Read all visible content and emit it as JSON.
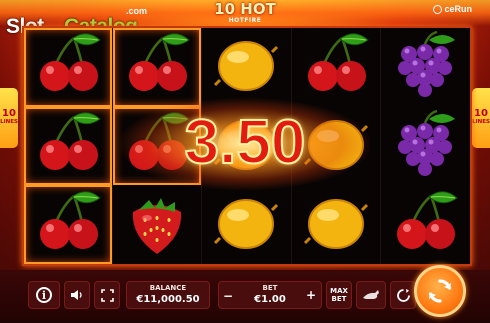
{
  "header": {
    "site_logo_main": "Slot",
    "site_logo_accent": "Catalog",
    "site_logo_tld": ".com",
    "game_title": "10 HOT",
    "game_subtitle": "HOTFIRE",
    "provider": "ceRun"
  },
  "side_tags": {
    "left_number": "10",
    "left_label": "LINES",
    "right_number": "10",
    "right_label": "LINES"
  },
  "reels": [
    [
      "cherry",
      "cherry",
      "lemon",
      "cherry",
      "grapes"
    ],
    [
      "cherry",
      "cherry",
      "lemon",
      "lemon",
      "grapes"
    ],
    [
      "cherry",
      "strawberry",
      "lemon",
      "lemon",
      "cherry"
    ]
  ],
  "winning_cells": [
    [
      0,
      0
    ],
    [
      0,
      1
    ],
    [
      1,
      0
    ],
    [
      1,
      1
    ],
    [
      2,
      0
    ]
  ],
  "win": {
    "amount": "3.50"
  },
  "controls": {
    "info_label": "i",
    "balance_label": "BALANCE",
    "balance_value": "€11,000.50",
    "bet_label": "BET",
    "bet_value": "€1.00",
    "bet_minus": "−",
    "bet_plus": "+",
    "max_bet_line1": "MAX",
    "max_bet_line2": "BET"
  },
  "colors": {
    "accent_orange": "#ff7a12",
    "win_red": "#e21c10",
    "bar_bg": "#3a0707",
    "logo_green": "#a6d83a"
  }
}
